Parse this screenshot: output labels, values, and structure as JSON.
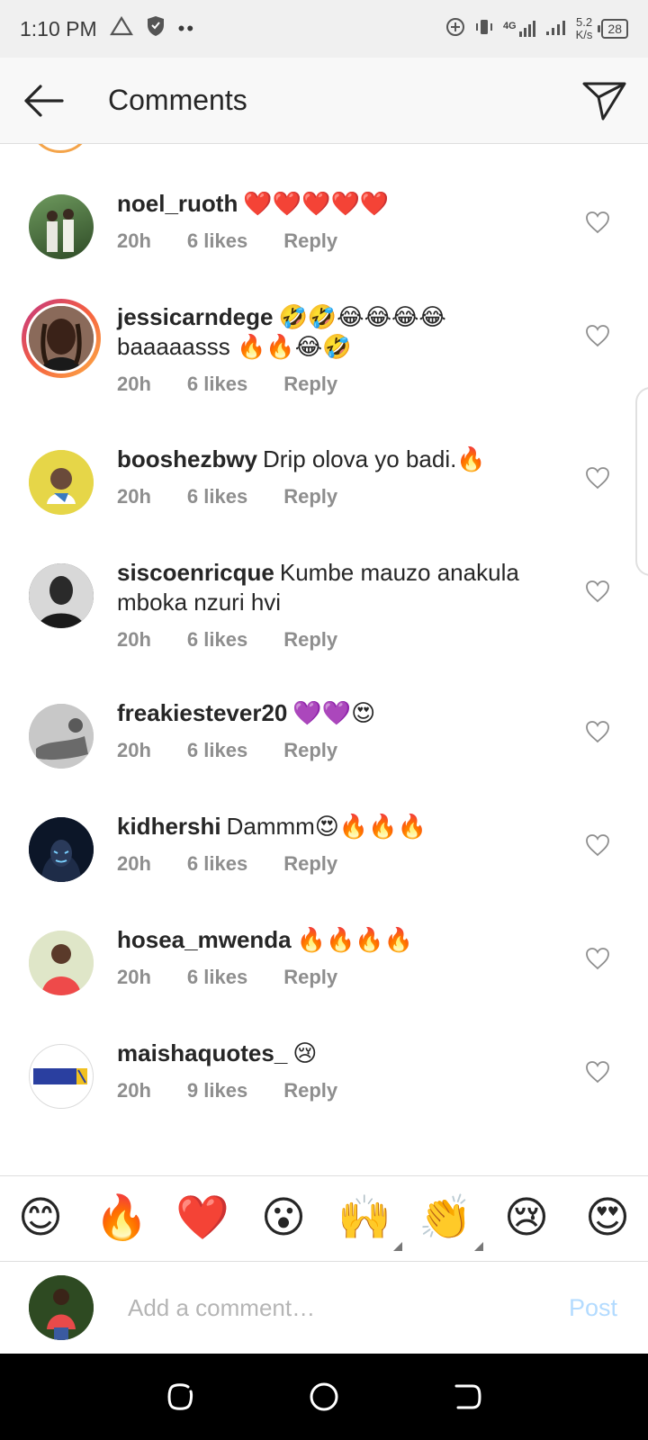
{
  "status_bar": {
    "time": "1:10 PM",
    "signal_label": "4G",
    "net_speed_value": "5.2",
    "net_speed_unit": "K/s",
    "battery": "28"
  },
  "header": {
    "title": "Comments"
  },
  "comments": [
    {
      "username": "noel_ruoth",
      "text": "❤️❤️❤️❤️❤️",
      "time": "20h",
      "likes": "6 likes",
      "reply": "Reply",
      "avatar_color": "#4d7a3e"
    },
    {
      "username": "jessicarndege",
      "text": "🤣🤣😂😂😂😂 baaaaasss 🔥🔥😂🤣",
      "time": "20h",
      "likes": "6 likes",
      "reply": "Reply",
      "avatar_color": "#6b4a3a"
    },
    {
      "username": "booshezbwy",
      "text": "Drip olova yo badi.🔥",
      "time": "20h",
      "likes": "6 likes",
      "reply": "Reply",
      "avatar_color": "#e8d84a"
    },
    {
      "username": "siscoenricque",
      "text": "Kumbe mauzo anakula mboka nzuri hvi",
      "time": "20h",
      "likes": "6 likes",
      "reply": "Reply",
      "avatar_color": "#3a3a3a"
    },
    {
      "username": "freakiestever20",
      "text": "💜💜😍",
      "time": "20h",
      "likes": "6 likes",
      "reply": "Reply",
      "avatar_color": "#9a9a9a"
    },
    {
      "username": "kidhershi",
      "text": "Dammm😍🔥🔥🔥",
      "time": "20h",
      "likes": "6 likes",
      "reply": "Reply",
      "avatar_color": "#1a2a4a"
    },
    {
      "username": "hosea_mwenda",
      "text": "🔥🔥🔥🔥",
      "time": "20h",
      "likes": "6 likes",
      "reply": "Reply",
      "avatar_color": "#6a8a3a"
    },
    {
      "username": "maishaquotes_",
      "text": "😢",
      "time": "20h",
      "likes": "9 likes",
      "reply": "Reply",
      "avatar_color": "#ffffff",
      "avatar_logo": "MAISHA QUOTES"
    }
  ],
  "emoji_bar": [
    "😊",
    "🔥",
    "❤️",
    "😮",
    "🙌",
    "👏",
    "😢",
    "😍"
  ],
  "composer": {
    "placeholder": "Add a comment…",
    "post_label": "Post"
  },
  "colors": {
    "meta_gray": "#8e8e8e",
    "post_disabled": "#b3dbff",
    "story_ring_start": "#c13584",
    "story_ring_end": "#fcaf45"
  }
}
